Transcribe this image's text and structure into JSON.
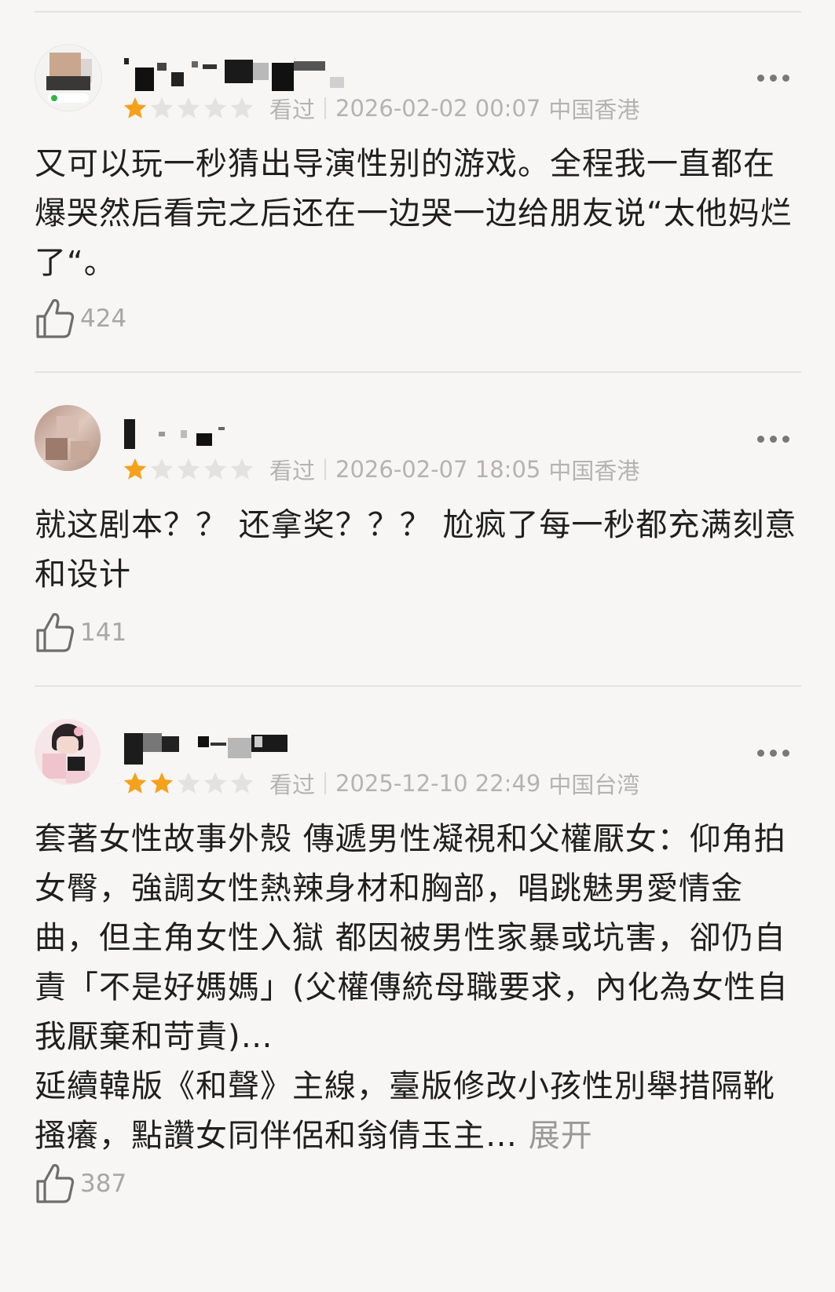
{
  "reviews": [
    {
      "username": "",
      "rating": 1,
      "watched_label": "看过",
      "datetime": "2026-02-02 00:07",
      "location": "中国香港",
      "content": [
        "又可以玩一秒猜出导演性别的游戏。全程我一直都在爆哭然后看完之后还在一边哭一边给朋友说“太他妈烂了“。"
      ],
      "likes": "424"
    },
    {
      "username": "",
      "rating": 1,
      "watched_label": "看过",
      "datetime": "2026-02-07 18:05",
      "location": "中国香港",
      "content": [
        "就这剧本？？ 还拿奖？？？ 尬疯了每一秒都充满刻意和设计"
      ],
      "likes": "141"
    },
    {
      "username": "",
      "rating": 2,
      "watched_label": "看过",
      "datetime": "2025-12-10 22:49",
      "location": "中国台湾",
      "content": [
        "套著女性故事外殼 傳遞男性凝視和父權厭女：仰角拍女臀，強調女性熱辣身材和胸部，唱跳魅男愛情金曲，但主角女性入獄 都因被男性家暴或坑害，卻仍自責「不是好媽媽」(父權傳統母職要求，內化為女性自我厭棄和苛責)…",
        "延續韓版《和聲》主線，臺版修改小孩性別舉措隔靴搔癢，點讚女同伴侶和翁倩玉主…"
      ],
      "expand_label": "展开",
      "likes": "387"
    }
  ],
  "colors": {
    "star_filled": "#f5a11c",
    "star_empty": "#e4e2df",
    "text": "#1f1f1f",
    "meta": "#b5b3b0",
    "background": "#f7f6f4"
  },
  "icons": [
    "more-icon",
    "thumbs-up-icon",
    "star-icon"
  ]
}
